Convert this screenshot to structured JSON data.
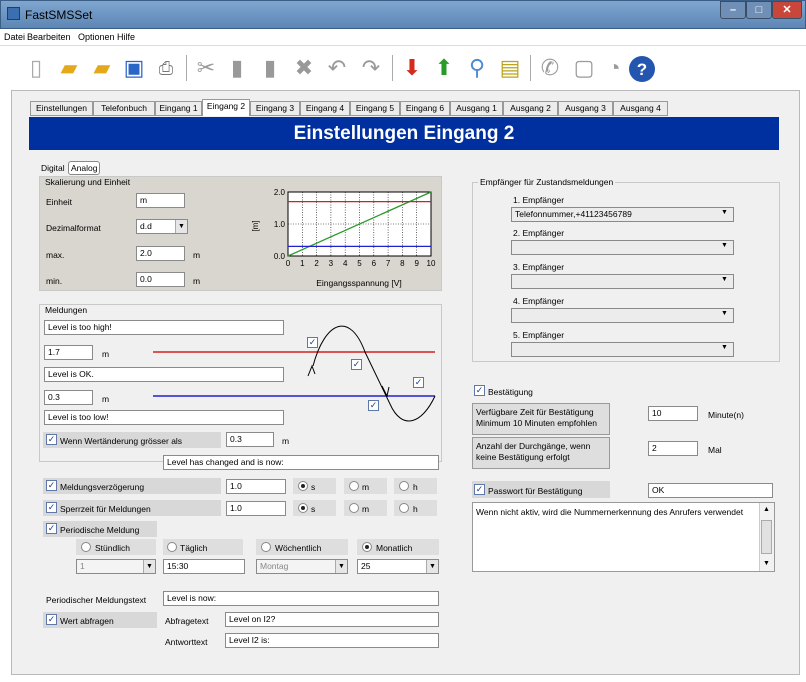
{
  "window": {
    "title": "FastSMSSet"
  },
  "menu": [
    "Datei",
    "Bearbeiten",
    "Optionen",
    "Hilfe"
  ],
  "tabs": [
    "Einstellungen",
    "Telefonbuch",
    "Eingang 1",
    "Eingang 2",
    "Eingang 3",
    "Eingang 4",
    "Eingang 5",
    "Eingang 6",
    "Ausgang 1",
    "Ausgang 2",
    "Ausgang 3",
    "Ausgang 4"
  ],
  "header": "Einstellungen Eingang 2",
  "mode": {
    "digital": "Digital",
    "analog": "Analog"
  },
  "skalierung": {
    "title": "Skalierung und Einheit",
    "einheit_label": "Einheit",
    "einheit": "m",
    "dezimal_label": "Dezimalformat",
    "dezimal": "d.d",
    "max_label": "max.",
    "max": "2.0",
    "min_label": "min.",
    "min": "0.0",
    "unit": "m"
  },
  "chart_data": {
    "type": "line",
    "xlabel": "Eingangsspannung [V]",
    "ylabel": "[m]",
    "xlim": [
      0,
      10
    ],
    "ylim": [
      0,
      2
    ],
    "xticks": [
      "0",
      "1",
      "2",
      "3",
      "4",
      "5",
      "6",
      "7",
      "8",
      "9",
      "10"
    ],
    "yticks": [
      "0.0",
      "1.0",
      "2.0"
    ],
    "series": [
      {
        "x": [
          0,
          10
        ],
        "y": [
          0,
          2
        ],
        "color": "#2a9a2a"
      },
      {
        "x": [
          0,
          10
        ],
        "y": [
          1.7,
          1.7
        ],
        "color": "#d42020"
      },
      {
        "x": [
          0,
          10
        ],
        "y": [
          0.3,
          0.3
        ],
        "color": "#2020d0"
      }
    ],
    "grid": true
  },
  "meldungen": {
    "title": "Meldungen",
    "high_text": "Level is too high!",
    "high_value": "1.7",
    "ok_text": "Level is OK.",
    "low_value": "0.3",
    "low_text": "Level is too low!",
    "unit": "m",
    "change_label": "Wenn Wertänderung grösser als",
    "change_value": "0.3",
    "change_text": "Level has changed and is now:"
  },
  "delay": {
    "label": "Meldungsverzögerung",
    "value": "1.0",
    "s": "s",
    "m": "m",
    "h": "h"
  },
  "sperr": {
    "label": "Sperrzeit für Meldungen",
    "value": "1.0",
    "s": "s",
    "m": "m",
    "h": "h"
  },
  "periodic": {
    "label": "Periodische Meldung",
    "options": [
      "Stündlich",
      "Täglich",
      "Wöchentlich",
      "Monatlich"
    ],
    "hour": "1",
    "time": "15:30",
    "weekday": "Montag",
    "day": "25",
    "text_label": "Periodischer Meldungstext",
    "text": "Level is now:"
  },
  "query": {
    "label": "Wert abfragen",
    "abfrage_label": "Abfragetext",
    "abfrage": "Level on I2?",
    "antwort_label": "Antworttext",
    "antwort": "Level I2 is:"
  },
  "empfaenger": {
    "title": "Empfänger für Zustandsmeldungen",
    "items": [
      {
        "label": "1. Empfänger",
        "value": "Telefonnummer,+41123456789"
      },
      {
        "label": "2. Empfänger",
        "value": ""
      },
      {
        "label": "3. Empfänger",
        "value": ""
      },
      {
        "label": "4. Empfänger",
        "value": ""
      },
      {
        "label": "5. Empfänger",
        "value": ""
      }
    ]
  },
  "bestaetigung": {
    "label": "Bestätigung",
    "zeit_label": "Verfügbare Zeit für Bestätigung Minimum 10 Minuten empfohlen",
    "zeit": "10",
    "zeit_unit": "Minute(n)",
    "durch_label": "Anzahl der Durchgänge, wenn keine Bestätigung erfolgt",
    "durch": "2",
    "durch_unit": "Mal",
    "pw_label": "Passwort für Bestätigung",
    "pw": "OK",
    "info": "Wenn nicht aktiv, wird die Nummernerkennung des Anrufers verwendet"
  },
  "colors": {
    "header": "#002fa0",
    "high": "#d42020",
    "low": "#2020d0",
    "line": "#2a9a2a"
  }
}
